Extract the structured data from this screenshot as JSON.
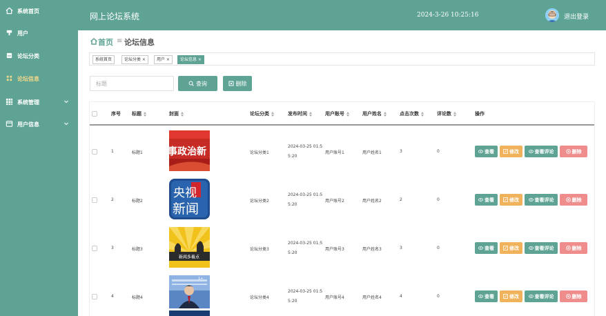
{
  "sidebar": {
    "items": [
      {
        "label": "系统首页",
        "icon": "home-icon",
        "active": false,
        "expandable": false
      },
      {
        "label": "用户",
        "icon": "user-icon",
        "active": false,
        "expandable": false
      },
      {
        "label": "论坛分类",
        "icon": "forum-category-icon",
        "active": false,
        "expandable": false
      },
      {
        "label": "论坛信息",
        "icon": "forum-info-icon",
        "active": true,
        "expandable": false
      },
      {
        "label": "系统管理",
        "icon": "grid-icon",
        "active": false,
        "expandable": true
      },
      {
        "label": "用户信息",
        "icon": "user-card-icon",
        "active": false,
        "expandable": true
      }
    ]
  },
  "header": {
    "title": "网上论坛系统",
    "datetime": "2024-3-26 10:25:16",
    "logout": "退出登录"
  },
  "breadcrumb": {
    "home": "首页",
    "current": "论坛信息"
  },
  "tags": [
    {
      "label": "系统首页",
      "closable": false,
      "active": false
    },
    {
      "label": "论坛分类",
      "closable": true,
      "active": false
    },
    {
      "label": "用户",
      "closable": true,
      "active": false
    },
    {
      "label": "论坛信息",
      "closable": true,
      "active": true
    }
  ],
  "search": {
    "placeholder": "标题",
    "query_label": "查询",
    "delete_label": "删除"
  },
  "table": {
    "headers": {
      "index": "序号",
      "title": "标题",
      "cover": "封面",
      "category": "论坛分类",
      "publish_time": "发布时间",
      "account": "用户账号",
      "name": "用户姓名",
      "clicks": "点击次数",
      "comments": "评论数",
      "actions": "操作"
    },
    "rows": [
      {
        "index": "1",
        "title": "标题1",
        "cover": "cover-news-politics",
        "cover_text": "事政治新",
        "category": "论坛分类1",
        "time": "2024-03-25 01:55:20",
        "account": "用户账号1",
        "name": "用户姓名1",
        "clicks": "3",
        "comments": "0"
      },
      {
        "index": "2",
        "title": "标题2",
        "cover": "cover-cctv-news",
        "cover_text": "央视新闻",
        "category": "论坛分类2",
        "time": "2024-03-25 01:55:20",
        "account": "用户账号2",
        "name": "用户姓名2",
        "clicks": "2",
        "comments": "0"
      },
      {
        "index": "3",
        "title": "标题3",
        "cover": "cover-news-reporter",
        "cover_text": "新闻多看点",
        "category": "论坛分类3",
        "time": "2024-03-25 01:55:20",
        "account": "用户账号3",
        "name": "用户姓名3",
        "clicks": "3",
        "comments": "0"
      },
      {
        "index": "4",
        "title": "标题4",
        "cover": "cover-news-anchor",
        "cover_text": "",
        "category": "论坛分类4",
        "time": "2024-03-25 01:55:20",
        "account": "用户账号4",
        "name": "用户姓名4",
        "clicks": "4",
        "comments": "0"
      }
    ],
    "actions": {
      "view": "查看",
      "edit": "修改",
      "view_comments": "查看评论",
      "delete": "删除"
    }
  },
  "colors": {
    "primary": "#5ea393",
    "active_menu": "#f7d88b",
    "edit": "#f0b35c",
    "delete": "#ef8d8d"
  }
}
